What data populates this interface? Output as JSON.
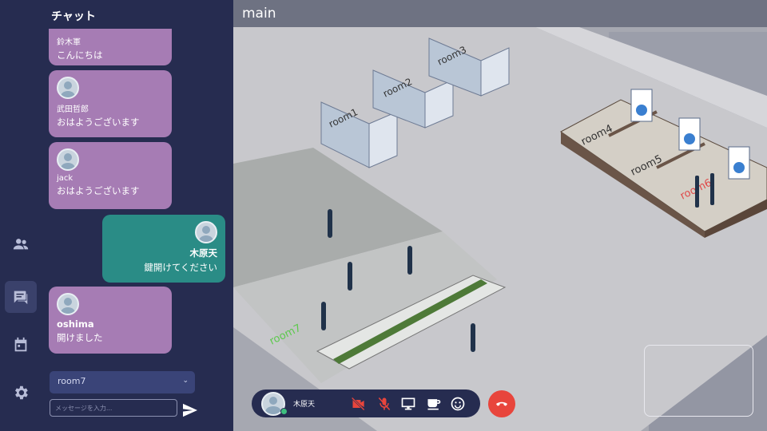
{
  "chat": {
    "title": "チャット",
    "messages": [
      {
        "sender": "鈴木軍",
        "text": "こんにちは",
        "side": "other"
      },
      {
        "sender": "武田哲郎",
        "text": "おはようございます",
        "side": "other"
      },
      {
        "sender": "jack",
        "text": "おはようございます",
        "side": "other"
      },
      {
        "sender": "木原天",
        "text": "鍵開けてください",
        "side": "mine"
      },
      {
        "sender": "oshima",
        "text": "開けました",
        "side": "other"
      }
    ],
    "room_select": "room7",
    "input_placeholder": "メッセージを入力..."
  },
  "main": {
    "title": "main",
    "rooms": [
      "room1",
      "room2",
      "room3",
      "room4",
      "room5",
      "room6",
      "room7"
    ]
  },
  "callbar": {
    "user_name": "木原天"
  },
  "icons": {
    "rail": [
      "people-icon",
      "chat-icon",
      "calendar-icon",
      "settings-icon"
    ],
    "call": [
      "camera-off-icon",
      "mic-off-icon",
      "screen-share-icon",
      "coffee-icon",
      "emoji-icon",
      "hangup-icon"
    ]
  },
  "colors": {
    "rail_bg": "#262c50",
    "bubble_other": "#a67cb4",
    "bubble_mine": "#2a8c86",
    "hangup": "#e8453c",
    "muted_red": "#e8453c",
    "room6_label": "#e04848",
    "room7_label": "#5cc94c"
  }
}
